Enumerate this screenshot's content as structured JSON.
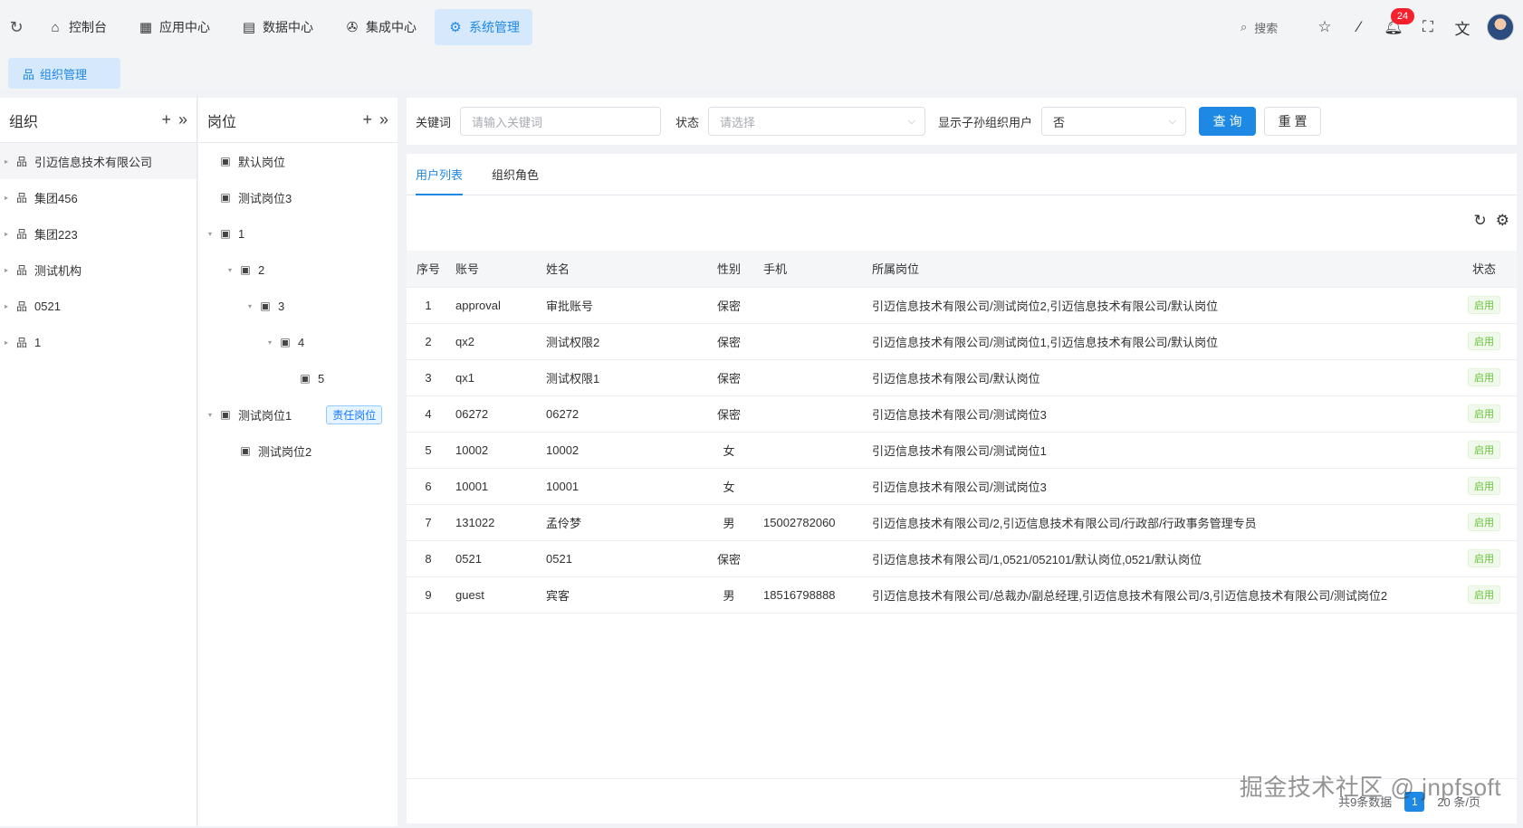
{
  "nav": {
    "items": [
      {
        "label": "控制台",
        "icon": "home-icon",
        "glyph": "⌂"
      },
      {
        "label": "应用中心",
        "icon": "grid-icon",
        "glyph": "▦"
      },
      {
        "label": "数据中心",
        "icon": "database-icon",
        "glyph": "▤"
      },
      {
        "label": "集成中心",
        "icon": "integration-icon",
        "glyph": "✇"
      },
      {
        "label": "系统管理",
        "icon": "gear-icon",
        "glyph": "⚙"
      }
    ],
    "search_label": "搜索",
    "notification_count": "24"
  },
  "page_tab": {
    "label": "组织管理"
  },
  "org_panel": {
    "title": "组织",
    "items": [
      {
        "label": "引迈信息技术有限公司"
      },
      {
        "label": "集团456"
      },
      {
        "label": "集团223"
      },
      {
        "label": "测试机构"
      },
      {
        "label": "0521"
      },
      {
        "label": "1"
      }
    ]
  },
  "pos_panel": {
    "title": "岗位",
    "items": [
      {
        "label": "默认岗位",
        "level": 0,
        "caret": ""
      },
      {
        "label": "测试岗位3",
        "level": 0,
        "caret": ""
      },
      {
        "label": "1",
        "level": 0,
        "caret": "▾"
      },
      {
        "label": "2",
        "level": 1,
        "caret": "▾"
      },
      {
        "label": "3",
        "level": 2,
        "caret": "▾"
      },
      {
        "label": "4",
        "level": 3,
        "caret": "▾"
      },
      {
        "label": "5",
        "level": 4,
        "caret": ""
      },
      {
        "label": "测试岗位1",
        "level": 0,
        "caret": "▾",
        "tag": "责任岗位"
      },
      {
        "label": "测试岗位2",
        "level": 1,
        "caret": ""
      }
    ]
  },
  "filter": {
    "keyword_label": "关键词",
    "keyword_placeholder": "请输入关键词",
    "status_label": "状态",
    "status_placeholder": "请选择",
    "sub_label": "显示子孙组织用户",
    "sub_value": "否",
    "query_button": "查 询",
    "reset_button": "重 置"
  },
  "tabs": [
    {
      "label": "用户列表"
    },
    {
      "label": "组织角色"
    }
  ],
  "table": {
    "headers": [
      "序号",
      "账号",
      "姓名",
      "性别",
      "手机",
      "所属岗位",
      "状态"
    ],
    "rows": [
      [
        "1",
        "approval",
        "审批账号",
        "保密",
        "",
        "引迈信息技术有限公司/测试岗位2,引迈信息技术有限公司/默认岗位",
        "启用"
      ],
      [
        "2",
        "qx2",
        "测试权限2",
        "保密",
        "",
        "引迈信息技术有限公司/测试岗位1,引迈信息技术有限公司/默认岗位",
        "启用"
      ],
      [
        "3",
        "qx1",
        "测试权限1",
        "保密",
        "",
        "引迈信息技术有限公司/默认岗位",
        "启用"
      ],
      [
        "4",
        "06272",
        "06272",
        "保密",
        "",
        "引迈信息技术有限公司/测试岗位3",
        "启用"
      ],
      [
        "5",
        "10002",
        "10002",
        "女",
        "",
        "引迈信息技术有限公司/测试岗位1",
        "启用"
      ],
      [
        "6",
        "10001",
        "10001",
        "女",
        "",
        "引迈信息技术有限公司/测试岗位3",
        "启用"
      ],
      [
        "7",
        "131022",
        "孟伶梦",
        "男",
        "15002782060",
        "引迈信息技术有限公司/2,引迈信息技术有限公司/行政部/行政事务管理专员",
        "启用"
      ],
      [
        "8",
        "0521",
        "0521",
        "保密",
        "",
        "引迈信息技术有限公司/1,0521/052101/默认岗位,0521/默认岗位",
        "启用"
      ],
      [
        "9",
        "guest",
        "宾客",
        "男",
        "18516798888",
        "引迈信息技术有限公司/总裁办/副总经理,引迈信息技术有限公司/3,引迈信息技术有限公司/测试岗位2",
        "启用"
      ]
    ]
  },
  "footer": {
    "total": "共9条数据",
    "page": "1",
    "page_size": "20 条/页"
  },
  "watermark": "掘金技术社区 @ jnpfsoft",
  "colors": {
    "accent": "#1e88e5",
    "active_bg": "#d6e8fb",
    "success": "#67c23a"
  }
}
